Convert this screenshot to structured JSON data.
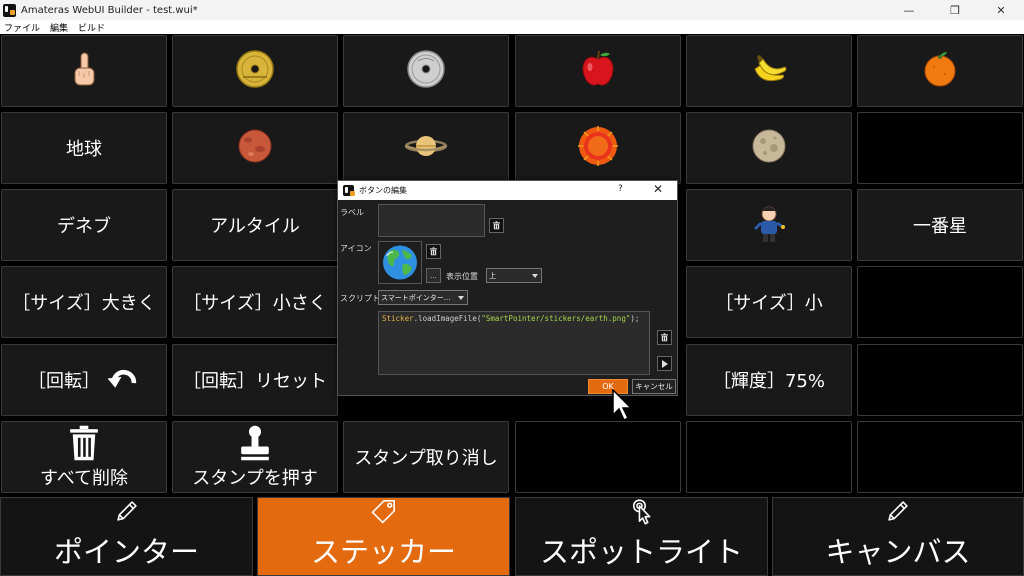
{
  "window": {
    "title": "Amateras WebUI Builder - test.wui*",
    "controls": {
      "minimize": "—",
      "restore": "❐",
      "close": "✕"
    }
  },
  "menu": [
    "ファイル",
    "編集",
    "ビルド"
  ],
  "grid": {
    "rows": [
      [
        {
          "type": "icon",
          "icon": "pointing-finger-icon"
        },
        {
          "type": "icon",
          "icon": "five-yen-coin-icon"
        },
        {
          "type": "icon",
          "icon": "fifty-yen-coin-icon"
        },
        {
          "type": "icon",
          "icon": "apple-icon"
        },
        {
          "type": "icon",
          "icon": "banana-icon"
        },
        {
          "type": "icon",
          "icon": "orange-icon"
        }
      ],
      [
        {
          "type": "text",
          "label": "地球"
        },
        {
          "type": "icon",
          "icon": "mars-icon"
        },
        {
          "type": "icon",
          "icon": "saturn-icon"
        },
        {
          "type": "icon",
          "icon": "sun-icon"
        },
        {
          "type": "icon",
          "icon": "moon-icon"
        },
        {
          "type": "empty"
        }
      ],
      [
        {
          "type": "text",
          "label": "デネブ"
        },
        {
          "type": "text",
          "label": "アルタイル"
        },
        {
          "type": "hidden"
        },
        {
          "type": "hidden"
        },
        {
          "type": "icon",
          "icon": "boy-icon"
        },
        {
          "type": "text",
          "label": "一番星"
        }
      ],
      [
        {
          "type": "text",
          "label": "［サイズ］大きく"
        },
        {
          "type": "text",
          "label": "［サイズ］小さく"
        },
        {
          "type": "hidden"
        },
        {
          "type": "hidden"
        },
        {
          "type": "text",
          "label": "［サイズ］小"
        },
        {
          "type": "empty"
        }
      ],
      [
        {
          "type": "text",
          "label": "［回転］",
          "icon": "rotate-left-icon"
        },
        {
          "type": "text",
          "label": "［回転］リセット"
        },
        {
          "type": "hidden"
        },
        {
          "type": "hidden"
        },
        {
          "type": "text",
          "label": "［輝度］75%"
        },
        {
          "type": "empty"
        }
      ],
      [
        {
          "type": "icontext",
          "label": "すべて削除",
          "icon": "trash-icon"
        },
        {
          "type": "icontext",
          "label": "スタンプを押す",
          "icon": "stamp-icon"
        },
        {
          "type": "text",
          "label": "スタンプ取り消し"
        },
        {
          "type": "empty"
        },
        {
          "type": "empty"
        },
        {
          "type": "empty"
        }
      ]
    ]
  },
  "tabs": [
    {
      "label": "ポインター",
      "icon": "pencil-icon",
      "active": false
    },
    {
      "label": "ステッカー",
      "icon": "tag-icon",
      "active": true
    },
    {
      "label": "スポットライト",
      "icon": "tap-icon",
      "active": false
    },
    {
      "label": "キャンバス",
      "icon": "pencil-icon",
      "active": false
    }
  ],
  "dialog": {
    "title": "ボタンの編集",
    "help": "?",
    "close": "✕",
    "label_caption": "ラベル",
    "label_value": "",
    "icon_caption": "アイコン",
    "browse_label": "...",
    "position_caption": "表示位置",
    "position_value": "上",
    "script_caption": "スクリプト",
    "script_type": "スマートポインター...",
    "script_code": {
      "class": "Sticker",
      "method": ".loadImageFile(",
      "arg": "\"SmartPointer/stickers/earth.png\"",
      "tail": ");"
    },
    "ok_label": "OK",
    "cancel_label": "キャンセル"
  },
  "colors": {
    "accent": "#e46a10",
    "cell_bg": "#191919",
    "cell_border": "#3a3a3a"
  }
}
